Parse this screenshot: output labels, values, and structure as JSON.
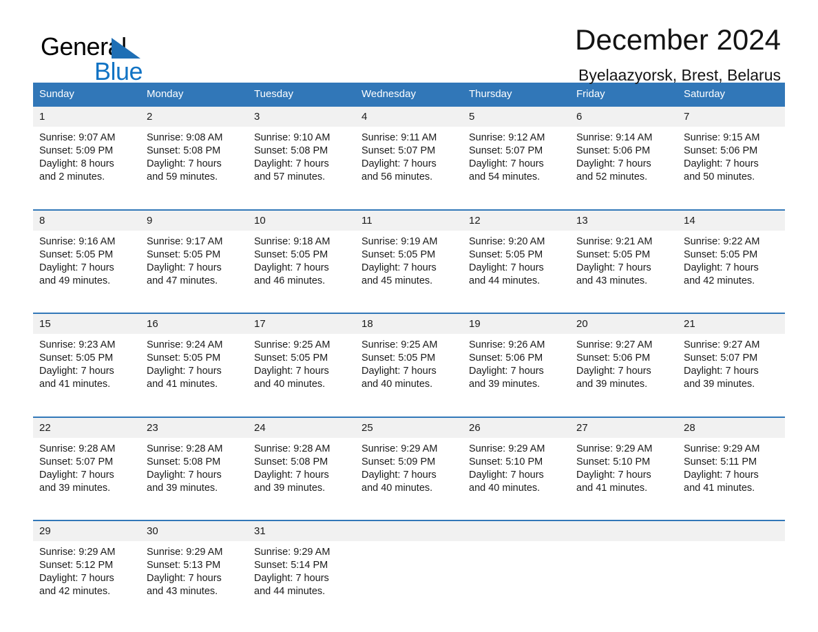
{
  "brand": {
    "name_part1": "General",
    "name_part2": "Blue",
    "triangle_color": "#1F6FB5",
    "blue_color": "#1173C4"
  },
  "header": {
    "title": "December 2024",
    "subtitle": "Byelaazyorsk, Brest, Belarus"
  },
  "theme": {
    "header_blue": "#3177B8",
    "date_band": "#F1F1F1",
    "text": "#1a1a1a"
  },
  "weekdays": [
    "Sunday",
    "Monday",
    "Tuesday",
    "Wednesday",
    "Thursday",
    "Friday",
    "Saturday"
  ],
  "weeks": [
    {
      "days": [
        {
          "date": "1",
          "sunrise": "Sunrise: 9:07 AM",
          "sunset": "Sunset: 5:09 PM",
          "daylight1": "Daylight: 8 hours",
          "daylight2": "and 2 minutes."
        },
        {
          "date": "2",
          "sunrise": "Sunrise: 9:08 AM",
          "sunset": "Sunset: 5:08 PM",
          "daylight1": "Daylight: 7 hours",
          "daylight2": "and 59 minutes."
        },
        {
          "date": "3",
          "sunrise": "Sunrise: 9:10 AM",
          "sunset": "Sunset: 5:08 PM",
          "daylight1": "Daylight: 7 hours",
          "daylight2": "and 57 minutes."
        },
        {
          "date": "4",
          "sunrise": "Sunrise: 9:11 AM",
          "sunset": "Sunset: 5:07 PM",
          "daylight1": "Daylight: 7 hours",
          "daylight2": "and 56 minutes."
        },
        {
          "date": "5",
          "sunrise": "Sunrise: 9:12 AM",
          "sunset": "Sunset: 5:07 PM",
          "daylight1": "Daylight: 7 hours",
          "daylight2": "and 54 minutes."
        },
        {
          "date": "6",
          "sunrise": "Sunrise: 9:14 AM",
          "sunset": "Sunset: 5:06 PM",
          "daylight1": "Daylight: 7 hours",
          "daylight2": "and 52 minutes."
        },
        {
          "date": "7",
          "sunrise": "Sunrise: 9:15 AM",
          "sunset": "Sunset: 5:06 PM",
          "daylight1": "Daylight: 7 hours",
          "daylight2": "and 50 minutes."
        }
      ]
    },
    {
      "days": [
        {
          "date": "8",
          "sunrise": "Sunrise: 9:16 AM",
          "sunset": "Sunset: 5:05 PM",
          "daylight1": "Daylight: 7 hours",
          "daylight2": "and 49 minutes."
        },
        {
          "date": "9",
          "sunrise": "Sunrise: 9:17 AM",
          "sunset": "Sunset: 5:05 PM",
          "daylight1": "Daylight: 7 hours",
          "daylight2": "and 47 minutes."
        },
        {
          "date": "10",
          "sunrise": "Sunrise: 9:18 AM",
          "sunset": "Sunset: 5:05 PM",
          "daylight1": "Daylight: 7 hours",
          "daylight2": "and 46 minutes."
        },
        {
          "date": "11",
          "sunrise": "Sunrise: 9:19 AM",
          "sunset": "Sunset: 5:05 PM",
          "daylight1": "Daylight: 7 hours",
          "daylight2": "and 45 minutes."
        },
        {
          "date": "12",
          "sunrise": "Sunrise: 9:20 AM",
          "sunset": "Sunset: 5:05 PM",
          "daylight1": "Daylight: 7 hours",
          "daylight2": "and 44 minutes."
        },
        {
          "date": "13",
          "sunrise": "Sunrise: 9:21 AM",
          "sunset": "Sunset: 5:05 PM",
          "daylight1": "Daylight: 7 hours",
          "daylight2": "and 43 minutes."
        },
        {
          "date": "14",
          "sunrise": "Sunrise: 9:22 AM",
          "sunset": "Sunset: 5:05 PM",
          "daylight1": "Daylight: 7 hours",
          "daylight2": "and 42 minutes."
        }
      ]
    },
    {
      "days": [
        {
          "date": "15",
          "sunrise": "Sunrise: 9:23 AM",
          "sunset": "Sunset: 5:05 PM",
          "daylight1": "Daylight: 7 hours",
          "daylight2": "and 41 minutes."
        },
        {
          "date": "16",
          "sunrise": "Sunrise: 9:24 AM",
          "sunset": "Sunset: 5:05 PM",
          "daylight1": "Daylight: 7 hours",
          "daylight2": "and 41 minutes."
        },
        {
          "date": "17",
          "sunrise": "Sunrise: 9:25 AM",
          "sunset": "Sunset: 5:05 PM",
          "daylight1": "Daylight: 7 hours",
          "daylight2": "and 40 minutes."
        },
        {
          "date": "18",
          "sunrise": "Sunrise: 9:25 AM",
          "sunset": "Sunset: 5:05 PM",
          "daylight1": "Daylight: 7 hours",
          "daylight2": "and 40 minutes."
        },
        {
          "date": "19",
          "sunrise": "Sunrise: 9:26 AM",
          "sunset": "Sunset: 5:06 PM",
          "daylight1": "Daylight: 7 hours",
          "daylight2": "and 39 minutes."
        },
        {
          "date": "20",
          "sunrise": "Sunrise: 9:27 AM",
          "sunset": "Sunset: 5:06 PM",
          "daylight1": "Daylight: 7 hours",
          "daylight2": "and 39 minutes."
        },
        {
          "date": "21",
          "sunrise": "Sunrise: 9:27 AM",
          "sunset": "Sunset: 5:07 PM",
          "daylight1": "Daylight: 7 hours",
          "daylight2": "and 39 minutes."
        }
      ]
    },
    {
      "days": [
        {
          "date": "22",
          "sunrise": "Sunrise: 9:28 AM",
          "sunset": "Sunset: 5:07 PM",
          "daylight1": "Daylight: 7 hours",
          "daylight2": "and 39 minutes."
        },
        {
          "date": "23",
          "sunrise": "Sunrise: 9:28 AM",
          "sunset": "Sunset: 5:08 PM",
          "daylight1": "Daylight: 7 hours",
          "daylight2": "and 39 minutes."
        },
        {
          "date": "24",
          "sunrise": "Sunrise: 9:28 AM",
          "sunset": "Sunset: 5:08 PM",
          "daylight1": "Daylight: 7 hours",
          "daylight2": "and 39 minutes."
        },
        {
          "date": "25",
          "sunrise": "Sunrise: 9:29 AM",
          "sunset": "Sunset: 5:09 PM",
          "daylight1": "Daylight: 7 hours",
          "daylight2": "and 40 minutes."
        },
        {
          "date": "26",
          "sunrise": "Sunrise: 9:29 AM",
          "sunset": "Sunset: 5:10 PM",
          "daylight1": "Daylight: 7 hours",
          "daylight2": "and 40 minutes."
        },
        {
          "date": "27",
          "sunrise": "Sunrise: 9:29 AM",
          "sunset": "Sunset: 5:10 PM",
          "daylight1": "Daylight: 7 hours",
          "daylight2": "and 41 minutes."
        },
        {
          "date": "28",
          "sunrise": "Sunrise: 9:29 AM",
          "sunset": "Sunset: 5:11 PM",
          "daylight1": "Daylight: 7 hours",
          "daylight2": "and 41 minutes."
        }
      ]
    },
    {
      "days": [
        {
          "date": "29",
          "sunrise": "Sunrise: 9:29 AM",
          "sunset": "Sunset: 5:12 PM",
          "daylight1": "Daylight: 7 hours",
          "daylight2": "and 42 minutes."
        },
        {
          "date": "30",
          "sunrise": "Sunrise: 9:29 AM",
          "sunset": "Sunset: 5:13 PM",
          "daylight1": "Daylight: 7 hours",
          "daylight2": "and 43 minutes."
        },
        {
          "date": "31",
          "sunrise": "Sunrise: 9:29 AM",
          "sunset": "Sunset: 5:14 PM",
          "daylight1": "Daylight: 7 hours",
          "daylight2": "and 44 minutes."
        },
        {
          "date": "",
          "sunrise": "",
          "sunset": "",
          "daylight1": "",
          "daylight2": ""
        },
        {
          "date": "",
          "sunrise": "",
          "sunset": "",
          "daylight1": "",
          "daylight2": ""
        },
        {
          "date": "",
          "sunrise": "",
          "sunset": "",
          "daylight1": "",
          "daylight2": ""
        },
        {
          "date": "",
          "sunrise": "",
          "sunset": "",
          "daylight1": "",
          "daylight2": ""
        }
      ]
    }
  ]
}
